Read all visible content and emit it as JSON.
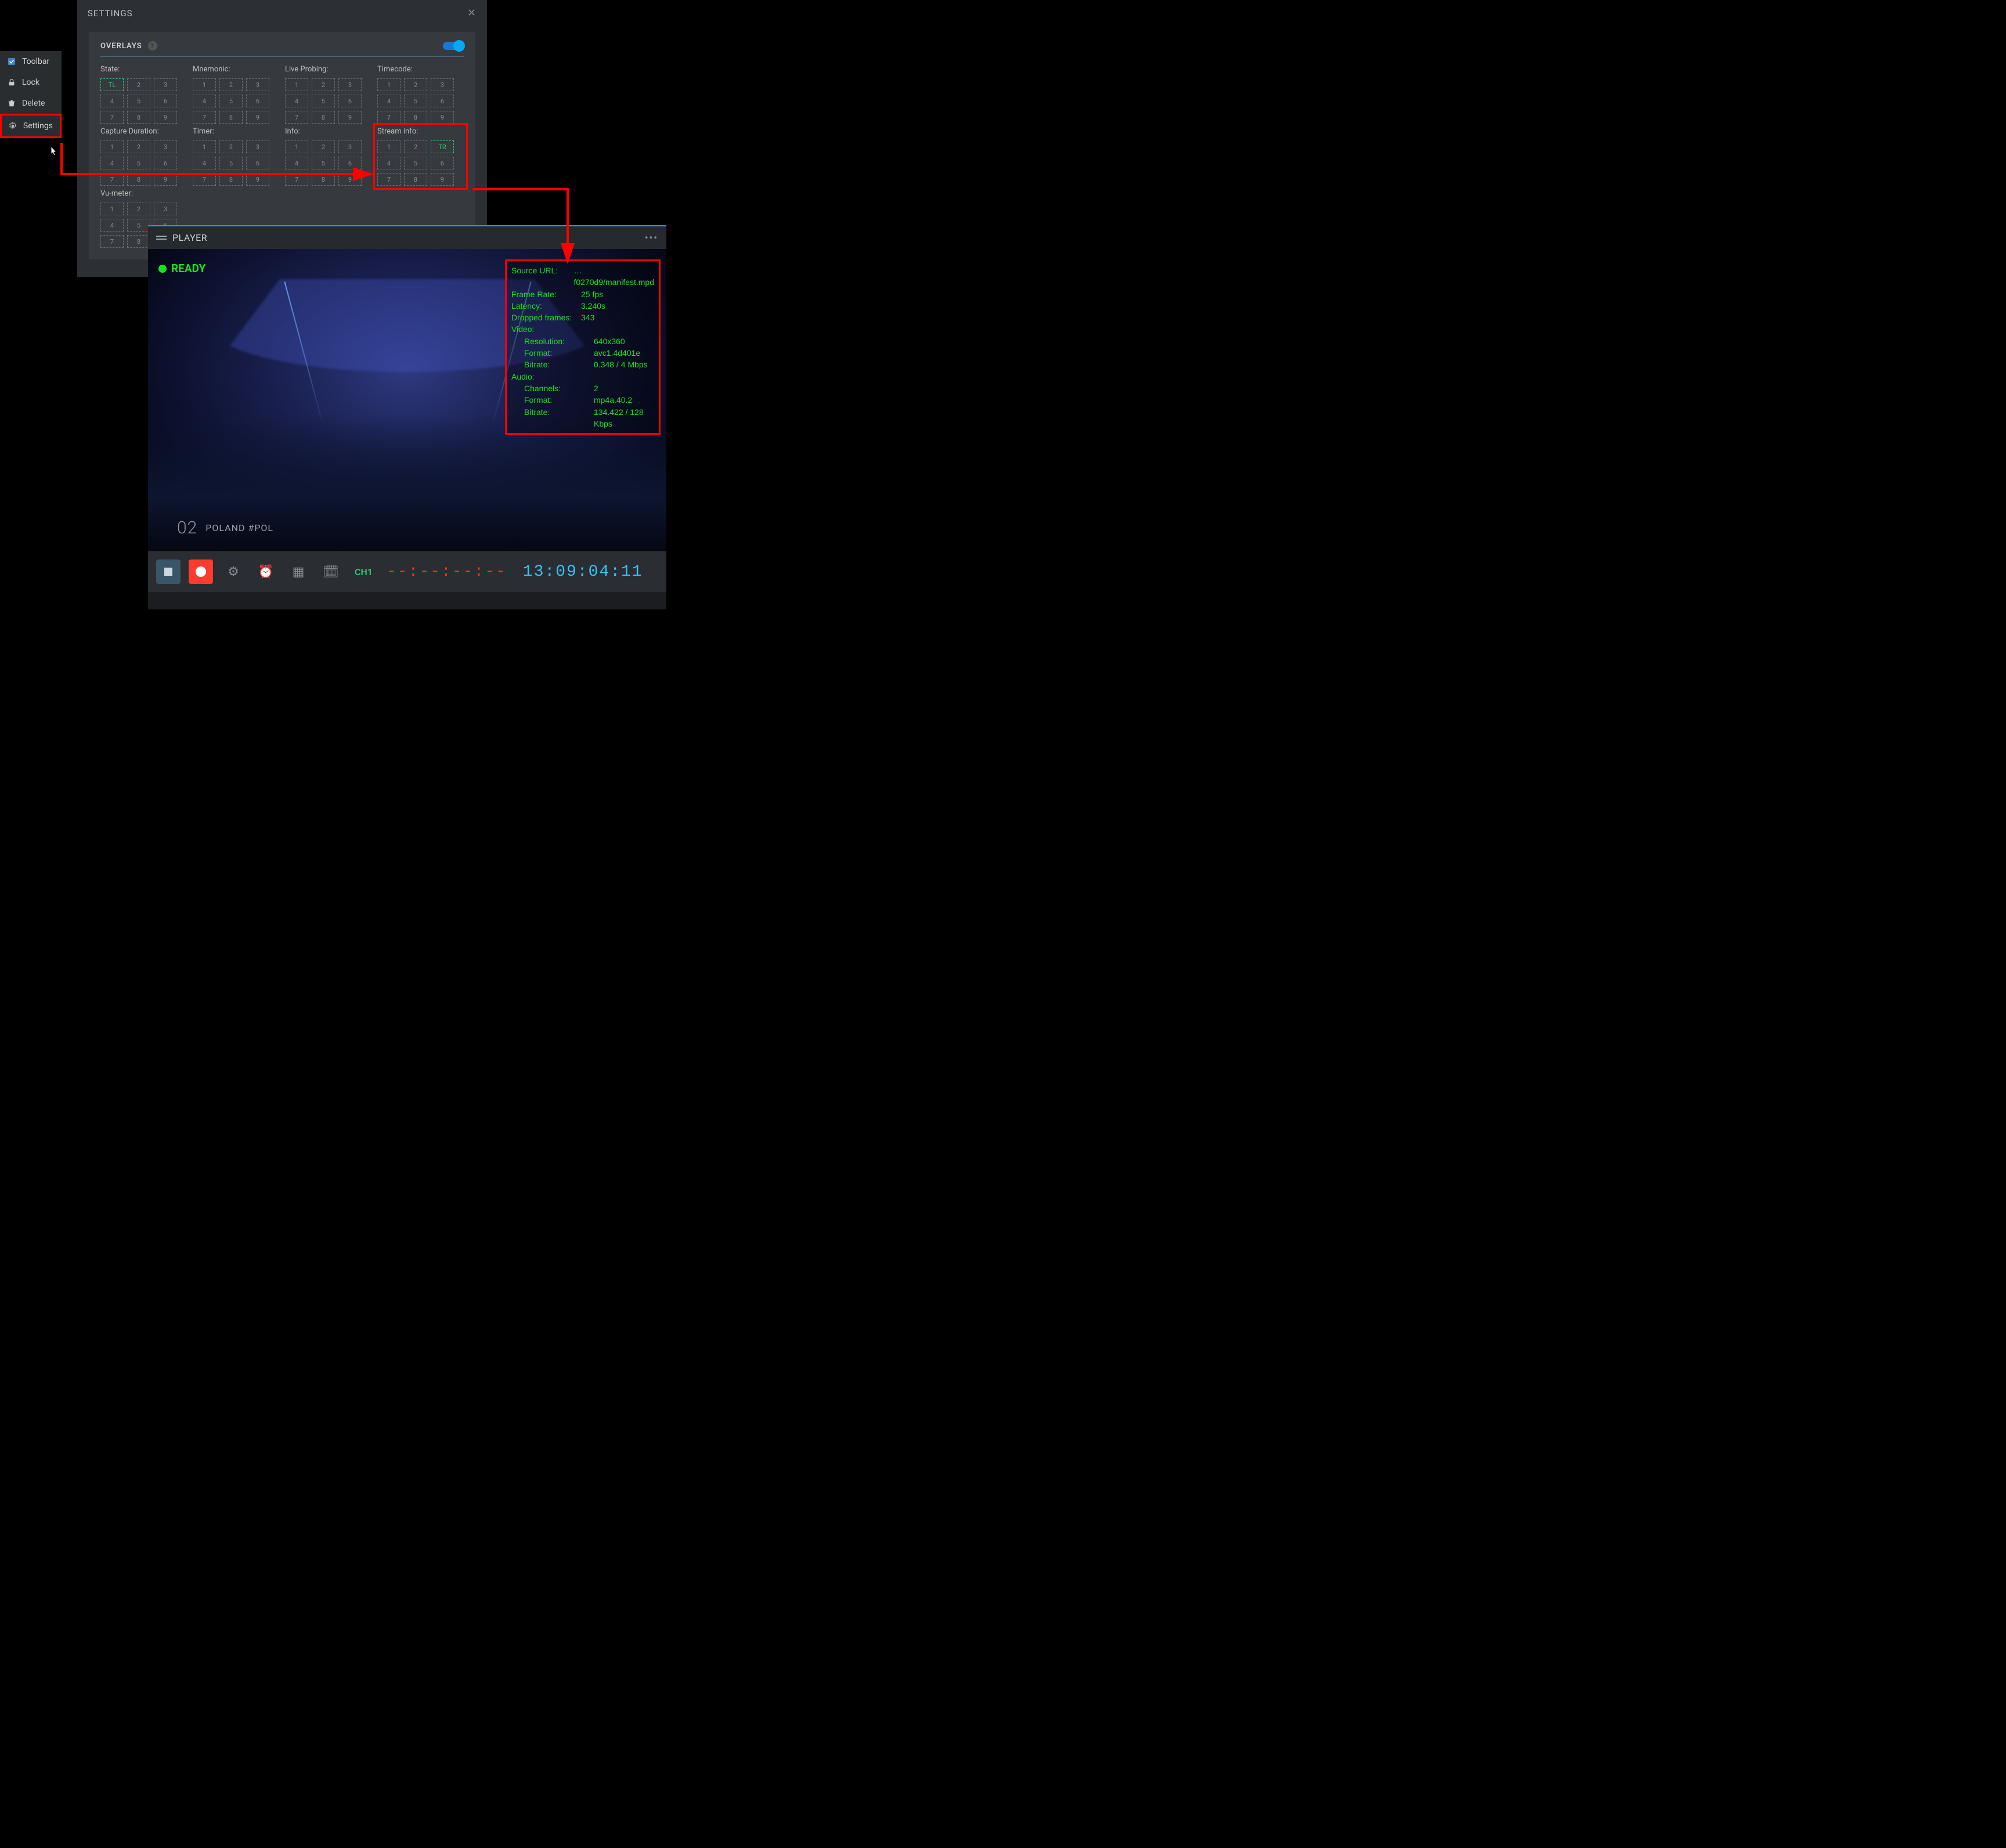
{
  "context_menu": {
    "items": [
      {
        "label": "Toolbar",
        "icon": "checkbox-checked-icon"
      },
      {
        "label": "Lock",
        "icon": "lock-icon"
      },
      {
        "label": "Delete",
        "icon": "trash-icon"
      },
      {
        "label": "Settings",
        "icon": "gear-icon"
      }
    ]
  },
  "settings": {
    "title": "SETTINGS",
    "section": "OVERLAYS",
    "toggle_on": true,
    "groups": [
      {
        "label": "State:",
        "active_index": 0,
        "active_text": "TL"
      },
      {
        "label": "Mnemonic:"
      },
      {
        "label": "Live Probing:"
      },
      {
        "label": "Timecode:"
      },
      {
        "label": "Capture Duration:"
      },
      {
        "label": "Timer:"
      },
      {
        "label": "Info:"
      },
      {
        "label": "Stream info:",
        "active_index": 2,
        "active_text": "TR",
        "red": true
      },
      {
        "label": "Vu-meter:"
      }
    ],
    "cell_numbers": [
      "1",
      "2",
      "3",
      "4",
      "5",
      "6",
      "7",
      "8",
      "9"
    ]
  },
  "player": {
    "title": "PLAYER",
    "ready": "READY",
    "watermark_number": "02",
    "watermark_text": "POLAND #POL",
    "channel": "CH1",
    "timecode_red": "--:--:--:--",
    "timecode_blue": "13:09:04:11"
  },
  "stream_info": {
    "rows": [
      {
        "label": "Source URL:",
        "value": "…f0270d9/manifest.mpd"
      },
      {
        "label": "Frame Rate:",
        "value": "25 fps"
      },
      {
        "label": "Latency:",
        "value": "3.240s"
      },
      {
        "label": "Dropped frames:",
        "value": "343"
      }
    ],
    "video_header": "Video:",
    "video": [
      {
        "label": "Resolution:",
        "value": "640x360"
      },
      {
        "label": "Format:",
        "value": "avc1.4d401e"
      },
      {
        "label": "Bitrate:",
        "value": "0.348 / 4 Mbps"
      }
    ],
    "audio_header": "Audio:",
    "audio": [
      {
        "label": "Channels:",
        "value": "2"
      },
      {
        "label": "Format:",
        "value": "mp4a.40.2"
      },
      {
        "label": "Bitrate:",
        "value": "134.422 / 128 Kbps"
      }
    ]
  }
}
